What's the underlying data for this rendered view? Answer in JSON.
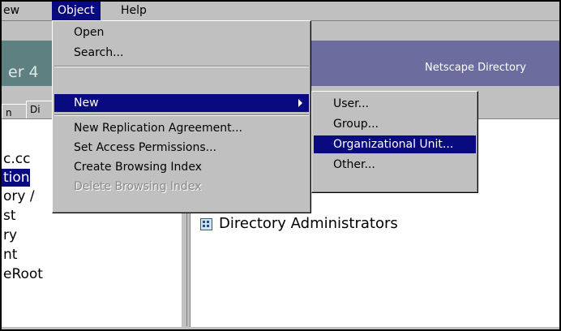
{
  "menubar": {
    "items": [
      {
        "label": "ew"
      },
      {
        "label": "Object"
      },
      {
        "label": "Help"
      }
    ]
  },
  "banner": {
    "left_fragment": "er 4",
    "title": "Netscape Directory"
  },
  "tabs": [
    {
      "label": "n"
    },
    {
      "label": "Di"
    }
  ],
  "tree": {
    "items": [
      {
        "label": "c.cc"
      },
      {
        "label": "tion"
      },
      {
        "label": "ory /"
      },
      {
        "label": "st"
      },
      {
        "label": "ry"
      },
      {
        "label": "nt"
      },
      {
        "label": "eRoot"
      }
    ]
  },
  "right_pane": {
    "entry": "Directory Administrators"
  },
  "object_menu": {
    "items": [
      {
        "label": "Open"
      },
      {
        "label": "Search..."
      },
      {
        "label": "New"
      },
      {
        "label": "New Replication Agreement..."
      },
      {
        "label": "Set Access Permissions..."
      },
      {
        "label": "Create Browsing Index"
      },
      {
        "label": "Delete Browsing Index"
      }
    ]
  },
  "new_submenu": {
    "items": [
      {
        "label": "User..."
      },
      {
        "label": "Group..."
      },
      {
        "label": "Organizational Unit..."
      },
      {
        "label": "Other..."
      }
    ]
  },
  "colors": {
    "highlight": "#0a0a80",
    "menu_face": "#c0c0c0",
    "banner": "#6c6c9e"
  }
}
